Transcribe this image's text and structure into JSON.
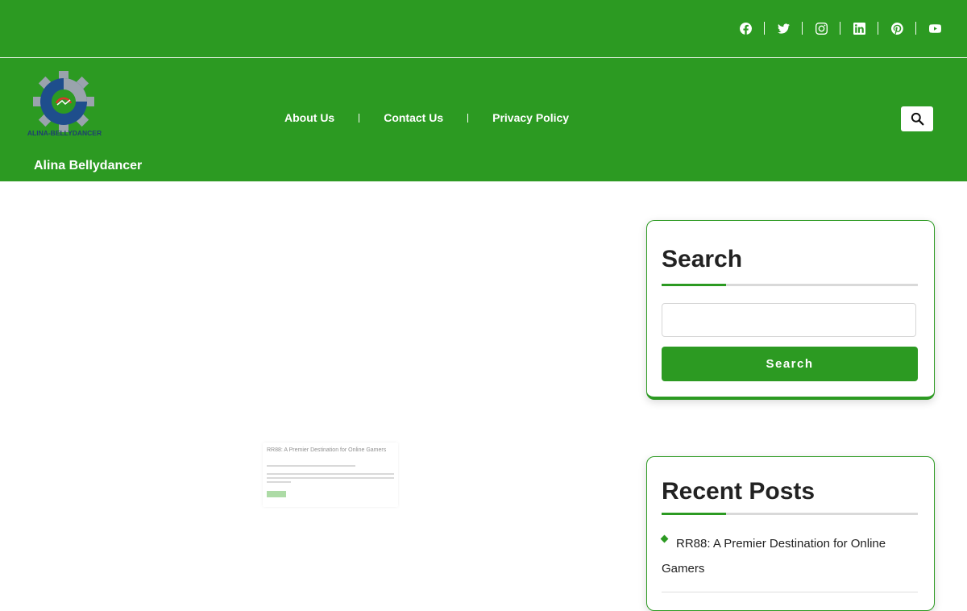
{
  "social": [
    {
      "icon": "facebook-icon"
    },
    {
      "icon": "twitter-icon"
    },
    {
      "icon": "instagram-icon"
    },
    {
      "icon": "linkedin-icon"
    },
    {
      "icon": "pinterest-icon"
    },
    {
      "icon": "youtube-icon"
    }
  ],
  "header": {
    "logo_text": "ALINA-BELLYDANCER",
    "site_title": "Alina Bellydancer",
    "nav": [
      {
        "label": "About Us"
      },
      {
        "label": "Contact Us"
      },
      {
        "label": "Privacy Policy"
      }
    ]
  },
  "featured": {
    "title": "RR88: A Premier Destination for Online Gamers"
  },
  "sidebar": {
    "search_widget": {
      "title": "Search",
      "input_value": "",
      "placeholder": "",
      "button_label": "Search"
    },
    "recent_widget": {
      "title": "Recent Posts",
      "items": [
        {
          "label_line1": "RR88: A Premier Destination for Online",
          "label_line2": "Gamers"
        }
      ]
    }
  },
  "colors": {
    "brand_green": "#2c9a22",
    "white": "#ffffff"
  }
}
